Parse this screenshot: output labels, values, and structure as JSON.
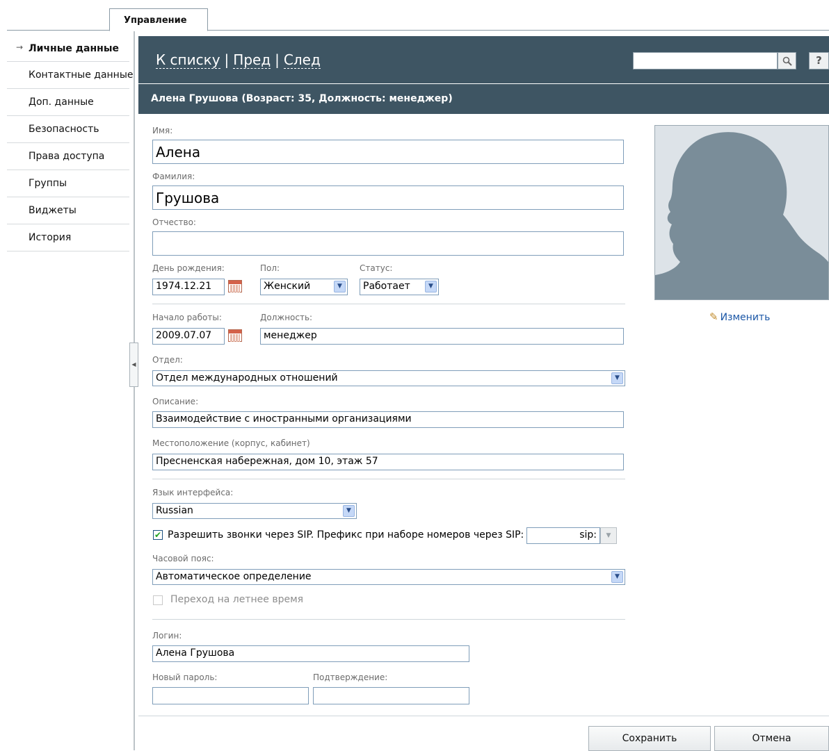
{
  "tabs": {
    "manage_label": "Управление"
  },
  "sidebar": {
    "items": [
      {
        "label": "Личные данные",
        "active": true
      },
      {
        "label": "Контактные данные"
      },
      {
        "label": "Доп. данные"
      },
      {
        "label": "Безопасность"
      },
      {
        "label": "Права доступа"
      },
      {
        "label": "Группы"
      },
      {
        "label": "Виджеты"
      },
      {
        "label": "История"
      }
    ],
    "active_arrow": "→"
  },
  "nav": {
    "to_list": "К списку",
    "prev": "Пред",
    "next": "След",
    "separator": "|",
    "help": "?",
    "search_value": ""
  },
  "title": "Алена Грушова (Возраст: 35, Должность: менеджер)",
  "form": {
    "first_name_label": "Имя:",
    "first_name": "Алена",
    "last_name_label": "Фамилия:",
    "last_name": "Грушова",
    "middle_name_label": "Отчество:",
    "middle_name": "",
    "birthday_label": "День рождения:",
    "birthday": "1974.12.21",
    "gender_label": "Пол:",
    "gender": "Женский",
    "status_label": "Статус:",
    "status": "Работает",
    "start_label": "Начало работы:",
    "start_date": "2009.07.07",
    "position_label": "Должность:",
    "position": "менеджер",
    "department_label": "Отдел:",
    "department": "Отдел международных отношений",
    "description_label": "Описание:",
    "description": "Взаимодействие с иностранными организациями",
    "location_label": "Местоположение (корпус, кабинет)",
    "location": "Пресненская набережная, дом 10, этаж 57",
    "language_label": "Язык интерфейса:",
    "language": "Russian",
    "sip_label": "Разрешить звонки через SIP. Префикс при наборе номеров через SIP:",
    "sip_checked": true,
    "sip_prefix": "sip:",
    "timezone_label": "Часовой пояс:",
    "timezone": "Автоматическое определение",
    "dst_label": "Переход на летнее время",
    "dst_checked": false,
    "login_label": "Логин:",
    "login": "Алена Грушова",
    "new_password_label": "Новый пароль:",
    "new_password": "",
    "confirm_label": "Подтверждение:",
    "confirm": ""
  },
  "photo": {
    "change_label": "Изменить"
  },
  "buttons": {
    "save": "Сохранить",
    "cancel": "Отмена"
  },
  "colors": {
    "header_bg": "#3e5563",
    "link": "#1a56a6",
    "input_border": "#7f9db9"
  }
}
